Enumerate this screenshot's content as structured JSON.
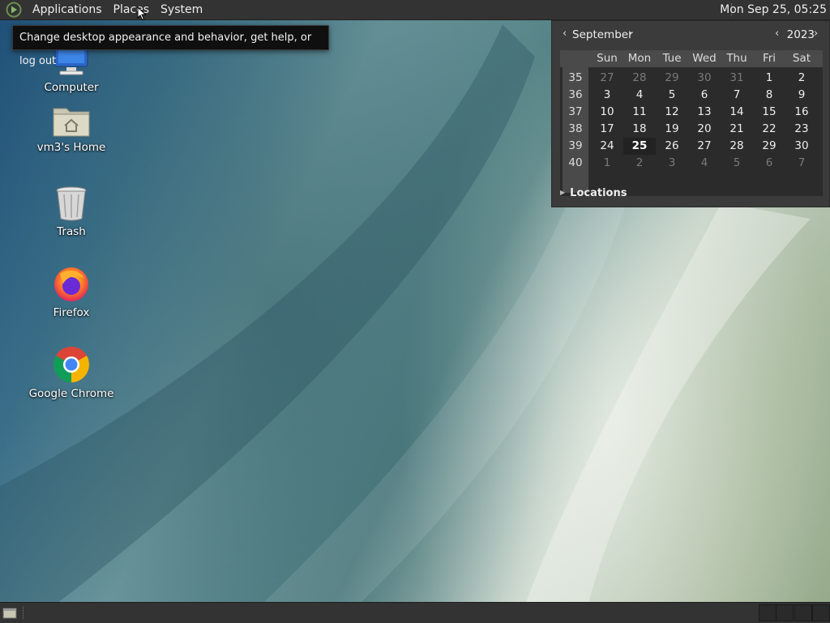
{
  "top_panel": {
    "menus": [
      "Applications",
      "Places",
      "System"
    ],
    "clock": "Mon Sep 25, 05:25"
  },
  "tooltip": {
    "text": "Change desktop appearance and behavior, get help, or log out"
  },
  "desktop": {
    "icons": [
      {
        "label": "Computer",
        "icon": "computer-icon"
      },
      {
        "label": "vm3's Home",
        "icon": "home-folder-icon"
      },
      {
        "label": "Trash",
        "icon": "trash-icon"
      },
      {
        "label": "Firefox",
        "icon": "firefox-icon"
      },
      {
        "label": "Google Chrome",
        "icon": "chrome-icon"
      }
    ]
  },
  "calendar": {
    "month": "September",
    "year": "2023",
    "prev_arrow": "‹",
    "next_arrow": "›",
    "weekday_headers": [
      "Sun",
      "Mon",
      "Tue",
      "Wed",
      "Thu",
      "Fri",
      "Sat"
    ],
    "weeks": [
      {
        "num": "35",
        "days": [
          {
            "d": "27",
            "dim": true
          },
          {
            "d": "28",
            "dim": true
          },
          {
            "d": "29",
            "dim": true
          },
          {
            "d": "30",
            "dim": true
          },
          {
            "d": "31",
            "dim": true
          },
          {
            "d": "1"
          },
          {
            "d": "2"
          }
        ]
      },
      {
        "num": "36",
        "days": [
          {
            "d": "3"
          },
          {
            "d": "4"
          },
          {
            "d": "5"
          },
          {
            "d": "6"
          },
          {
            "d": "7"
          },
          {
            "d": "8"
          },
          {
            "d": "9"
          }
        ]
      },
      {
        "num": "37",
        "days": [
          {
            "d": "10"
          },
          {
            "d": "11"
          },
          {
            "d": "12"
          },
          {
            "d": "13"
          },
          {
            "d": "14"
          },
          {
            "d": "15"
          },
          {
            "d": "16"
          }
        ]
      },
      {
        "num": "38",
        "days": [
          {
            "d": "17"
          },
          {
            "d": "18"
          },
          {
            "d": "19"
          },
          {
            "d": "20"
          },
          {
            "d": "21"
          },
          {
            "d": "22"
          },
          {
            "d": "23"
          }
        ]
      },
      {
        "num": "39",
        "days": [
          {
            "d": "24"
          },
          {
            "d": "25",
            "today": true
          },
          {
            "d": "26"
          },
          {
            "d": "27"
          },
          {
            "d": "28"
          },
          {
            "d": "29"
          },
          {
            "d": "30"
          }
        ]
      },
      {
        "num": "40",
        "days": [
          {
            "d": "1",
            "dim": true
          },
          {
            "d": "2",
            "dim": true
          },
          {
            "d": "3",
            "dim": true
          },
          {
            "d": "4",
            "dim": true
          },
          {
            "d": "5",
            "dim": true
          },
          {
            "d": "6",
            "dim": true
          },
          {
            "d": "7",
            "dim": true
          }
        ]
      }
    ],
    "locations_label": "Locations"
  },
  "colors": {
    "panel": "#333333",
    "popup": "#3b3b3b",
    "today_bg": "#222222"
  }
}
